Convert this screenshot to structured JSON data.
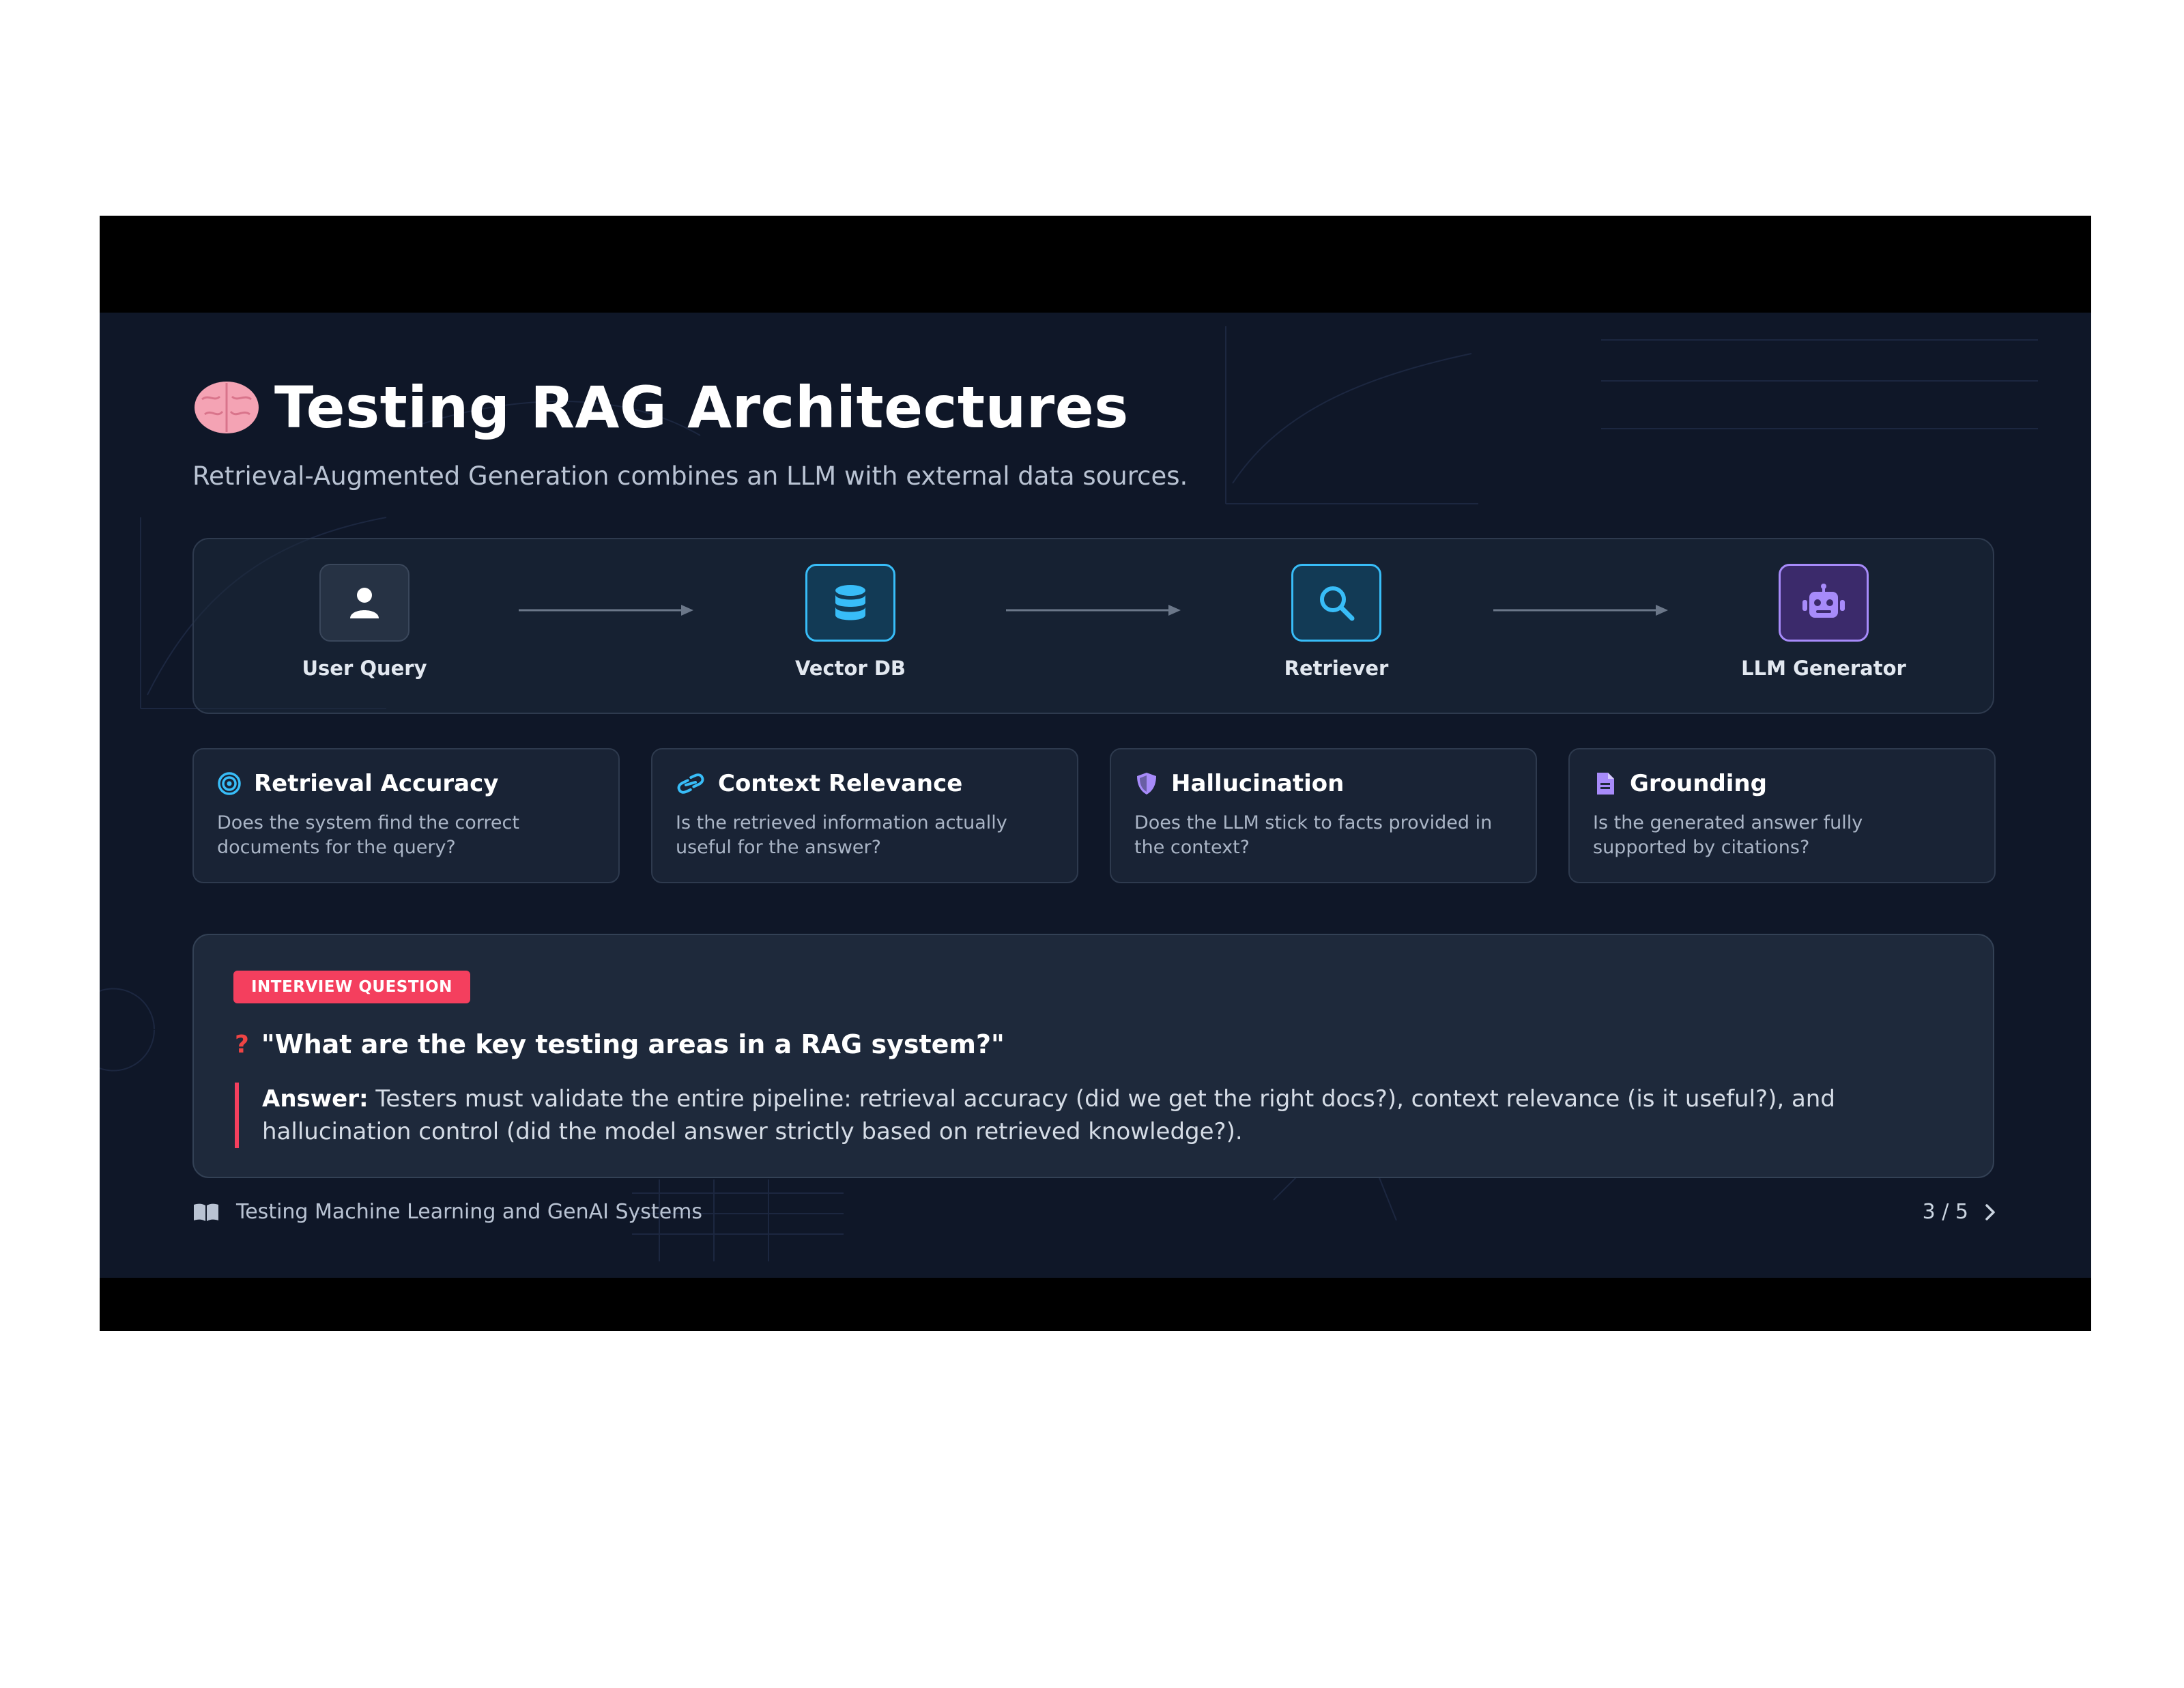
{
  "slide": {
    "title": "Testing RAG Architectures",
    "title_emoji": "brain-icon",
    "subtitle": "Retrieval-Augmented Generation combines an LLM with external data sources."
  },
  "pipeline": {
    "nodes": [
      {
        "label": "User Query",
        "icon": "user-icon"
      },
      {
        "label": "Vector DB",
        "icon": "database-icon"
      },
      {
        "label": "Retriever",
        "icon": "search-icon"
      },
      {
        "label": "LLM Generator",
        "icon": "robot-icon"
      }
    ]
  },
  "cards": [
    {
      "title": "Retrieval Accuracy",
      "desc_line1": "Does the system find the correct",
      "desc_line2": "documents for the query?",
      "icon": "target-icon"
    },
    {
      "title": "Context Relevance",
      "desc_line1": "Is the retrieved information actually",
      "desc_line2": "useful for the answer?",
      "icon": "link-icon"
    },
    {
      "title": "Hallucination",
      "desc_line1": "Does the LLM stick to facts provided in",
      "desc_line2": "the context?",
      "icon": "shield-icon"
    },
    {
      "title": "Grounding",
      "desc_line1": "Is the generated answer fully",
      "desc_line2": "supported by citations?",
      "icon": "file-icon"
    }
  ],
  "interview": {
    "badge": "INTERVIEW QUESTION",
    "qmark": "?",
    "question": "\"What are the key testing areas in a RAG system?\"",
    "answer_label": "Answer:",
    "answer_line1": " Testers must validate the entire pipeline: retrieval accuracy (did we get the right docs?), context relevance (is it useful?), and",
    "answer_line2": "hallucination control (did the model answer strictly based on retrieved knowledge?)."
  },
  "footer": {
    "course": "Testing Machine Learning and GenAI Systems",
    "page": "3 / 5"
  },
  "colors": {
    "background": "#0f1728",
    "accent_blue": "#38bdf8",
    "accent_purple": "#a78bfa",
    "accent_red": "#f43f5e"
  }
}
